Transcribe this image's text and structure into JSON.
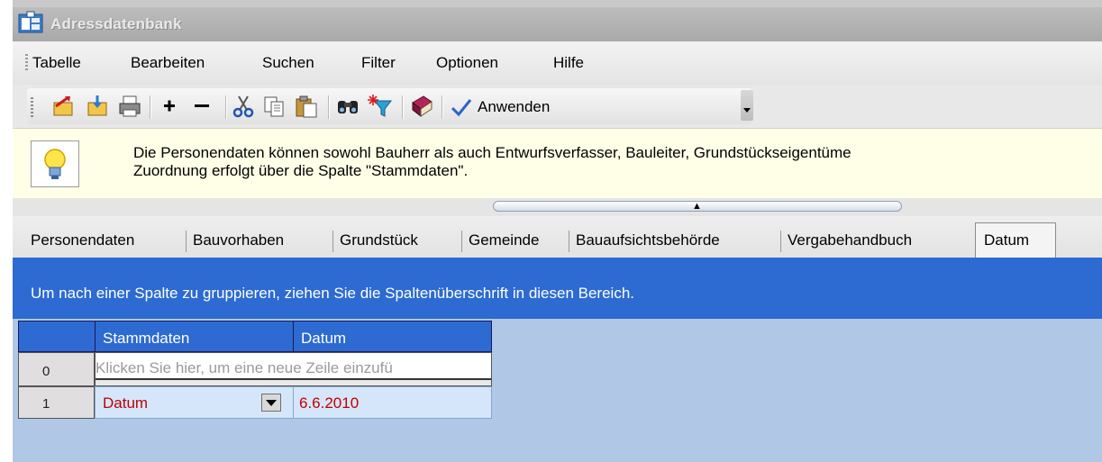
{
  "window": {
    "title": "Adressdatenbank"
  },
  "menu": {
    "items": [
      "Tabelle",
      "Bearbeiten",
      "Suchen",
      "Filter",
      "Optionen",
      "Hilfe"
    ]
  },
  "toolbar": {
    "buttons": [
      "export-icon",
      "import-icon",
      "print-icon",
      "add-icon",
      "remove-icon",
      "cut-icon",
      "copy-icon",
      "paste-icon",
      "find-icon",
      "filter-icon",
      "book-icon",
      "apply-icon"
    ],
    "apply_label": "Anwenden"
  },
  "info": {
    "line1": "Die Personendaten können sowohl Bauherr als auch Entwurfsverfasser, Bauleiter, Grundstückseigentüme",
    "line2": "Zuordnung erfolgt über die Spalte \"Stammdaten\"."
  },
  "tabs": {
    "items": [
      "Personendaten",
      "Bauvorhaben",
      "Grundstück",
      "Gemeinde",
      "Bauaufsichtsbehörde",
      "Vergabehandbuch",
      "Datum"
    ],
    "active": "Datum"
  },
  "group_panel": {
    "text": "Um nach einer Spalte zu gruppieren, ziehen Sie die Spaltenüberschrift in diesen Bereich."
  },
  "grid": {
    "columns": [
      "Stammdaten",
      "Datum"
    ],
    "new_row_hint": "Klicken Sie hier, um eine neue Zeile einzufü",
    "rows": [
      {
        "num": "0"
      },
      {
        "num": "1",
        "stammdaten": "Datum",
        "datum": "6.6.2010"
      }
    ],
    "colors": {
      "header": "#2d6ad1",
      "value_text": "#c00000",
      "background": "#b0c8e6"
    }
  }
}
